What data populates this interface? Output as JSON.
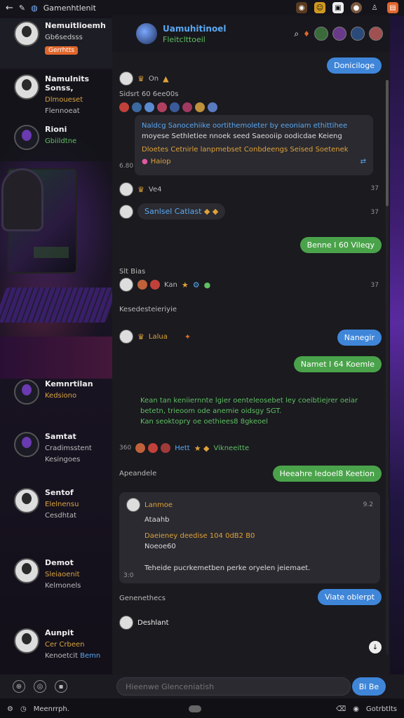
{
  "status_bar": {
    "title": "Gamenhtlenit",
    "icons": [
      "back-icon",
      "edit-icon",
      "globe-icon",
      "bell-icon",
      "emoji-icon",
      "image-icon",
      "avatar-icon",
      "user-icon",
      "menu-icon"
    ]
  },
  "contacts": [
    {
      "name": "Nemuitlioemh",
      "sub": "Gb6sedsss",
      "badge": "Gerrhtts",
      "active": true
    },
    {
      "name": "Namulnits Sonss,",
      "sub": "Dlmoueset",
      "meta": "Flennoeat"
    },
    {
      "name": "Rioni",
      "sub": "Gbiildtne",
      "dark": true
    },
    {
      "name": "Kemnrtilan",
      "sub": "Kedsiono"
    },
    {
      "name": "Samtat",
      "sub": "Cradimsstent",
      "meta": "Kesingoes"
    },
    {
      "name": "Sentof",
      "sub": "Elelnensu",
      "meta": "Cesdhtat"
    },
    {
      "name": "Demot",
      "sub": "Sleiaoenit",
      "meta": "Kelmonels"
    },
    {
      "name": "Aunpit",
      "sub": "Cer Crbeen",
      "meta": "Kenoetcit",
      "extra": "Bemn"
    }
  ],
  "header": {
    "title": "Uamuhitinoel",
    "subtitle": "Fleitclttoeil"
  },
  "messages": {
    "m1": "Doniciloge",
    "m2_name": "On",
    "m2_sub": "Sidsrt 60 6ee00s",
    "card1_line1": "Naldcg Sanocehiike oortithemoleter by eeoniam ethittihee",
    "card1_line2": "moyese Sethletiee nnoek seed Saeooiip oodicdae Keieng",
    "card1_line3": "Dloetes Cetnirle lanpmebset Conbdeengs Seised Soetenek",
    "card1_time": "6.80",
    "card1_tag": "Haiop",
    "m3_name": "Ve4",
    "m3_time": "37",
    "m4": "Sanlsel Catlast",
    "m4_time": "37",
    "m5": "Benne I 60 Vileqy",
    "m6_meta": "Slt Bias",
    "m6_reacts": "Kan",
    "m6_time": "37",
    "m7_label": "Kesedesteieriyie",
    "m8_name": "Lalua",
    "m8_reply": "Nanegir",
    "m9": "Namet I 64 Koemle",
    "m10_line1": "Kean tan keniiernnte lgier oenteleosebet ley coeibtiejrer oeiar",
    "m10_line2": "betetn, trieoom ode anemie oidsgy SGT.",
    "m10_line3": "Kan seoktopry oe oethiees8 8gkeoel",
    "m11_time": "360",
    "m11_react": "Hett",
    "m11_extra": "Vikneeitte",
    "m12_label": "Apeandele",
    "m12": "Heeahre Iedoel8 Keetion",
    "card2_name": "Lanmoe",
    "card2_line1": "Ataahb",
    "card2_line2": "Daeieney deedise 104 0dB2 B0",
    "card2_line3": "Noeoe60",
    "card2_line4": "Teheide pucrkemetben perke oryelen jeiemaet.",
    "card2_time": "3:0",
    "card2_t2": "9.2",
    "m13_label": "Genenethecs",
    "m13": "Viate oblerpt",
    "m14_name": "Deshlant"
  },
  "composer": {
    "placeholder": "Hieenwe Glenceniatish",
    "send_label": "Bi Be"
  },
  "navbar": {
    "left_label": "Meenrrph.",
    "right_label": "Gotrbtlts"
  },
  "colors": {
    "blue": "#3f86d9",
    "green": "#4aa34a",
    "orange": "#e0a13a",
    "bg": "#1a1a1f"
  }
}
